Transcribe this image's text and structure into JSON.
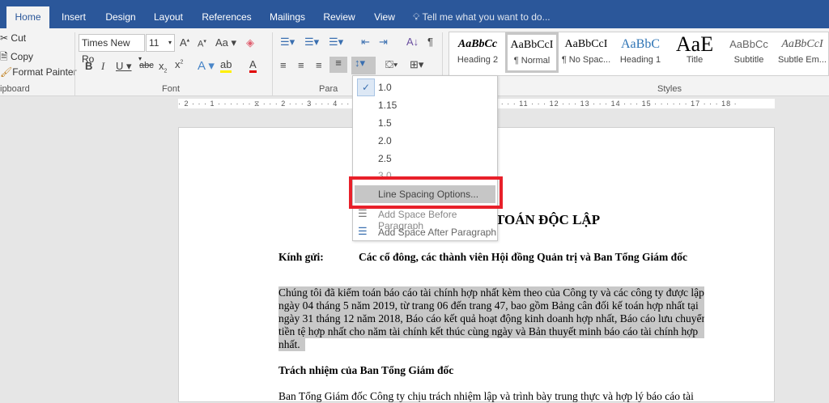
{
  "tabs": [
    "Home",
    "Insert",
    "Design",
    "Layout",
    "References",
    "Mailings",
    "Review",
    "View"
  ],
  "tell_me": "Tell me what you want to do...",
  "clipboard": {
    "cut": "Cut",
    "copy": "Copy",
    "format_painter": "Format Painter",
    "label": "ipboard"
  },
  "font": {
    "name": "Times New Ro",
    "size": "11",
    "label": "Font",
    "case": "Aa"
  },
  "paragraph": {
    "label": "Para"
  },
  "styles": {
    "label": "Styles",
    "items": [
      {
        "preview": "AaBbCc",
        "name": "Heading 2"
      },
      {
        "preview": "AaBbCcI",
        "name": "¶ Normal"
      },
      {
        "preview": "AaBbCcI",
        "name": "¶ No Spac..."
      },
      {
        "preview": "AaBbC",
        "name": "Heading 1"
      },
      {
        "preview": "AaE",
        "name": "Title"
      },
      {
        "preview": "AaBbCc",
        "name": "Subtitle"
      },
      {
        "preview": "AaBbCcI",
        "name": "Subtle Em..."
      }
    ]
  },
  "ruler": "· 2 · · · 1 · · ·   · · · ⧖ · · · 2 · · · 3 · · · 4 · · · 5 · · · 6 · · · 7 · · · 8 · · · 9 · · · 10 · · · 11 · · · 12 · · · 13 · · · 14 · · · 15 · · · · · · 17 · · · 18 ·",
  "line_spacing_menu": {
    "options": [
      "1.0",
      "1.15",
      "1.5",
      "2.0",
      "2.5",
      "3.0"
    ],
    "selected": "1.0",
    "line_spacing_options": "Line Spacing Options...",
    "add_before": "Add Space Before Paragraph",
    "add_after": "Add Space After Paragraph"
  },
  "document": {
    "title": "TOÁN ĐỘC LẬP",
    "to_label": "Kính gửi:",
    "to_value": "Các cổ đông, các thành viên Hội đồng Quản trị và Ban Tổng Giám đốc",
    "para1": [
      "Chúng tôi đã kiểm toán báo cáo tài chính hợp nhất kèm theo của Công ty và các công ty được lập",
      "ngày 04 tháng 5 năm 2019, từ trang 06 đến trang 47, bao gồm Bảng cân đối kế toán hợp nhất tại",
      "ngày 31 tháng 12 năm 2018, Báo cáo kết quả hoạt động kinh doanh hợp nhất, Báo cáo lưu chuyển",
      "tiền tệ hợp nhất cho năm tài chính kết thúc cùng ngày và Bản thuyết minh báo cáo tài chính hợp",
      "nhất."
    ],
    "heading2": "Trách nhiệm của Ban Tổng Giám đốc",
    "para2": "Ban Tổng Giám đốc Công ty chịu trách nhiệm lập và trình bày trung thực và hợp lý báo cáo tài"
  }
}
